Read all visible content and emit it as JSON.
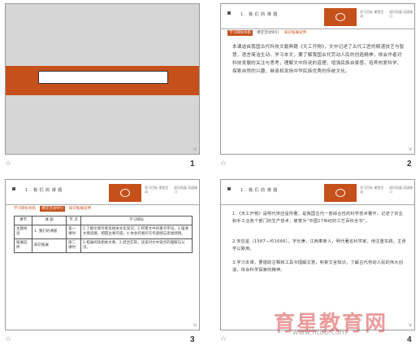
{
  "slides": [
    {
      "page": "1"
    },
    {
      "page": "2",
      "header_text": "1 . 我 们 的 课 题",
      "stamp1": "学习目标 课堂活动",
      "stamp2": "知识拓展 巩固练习",
      "tabs": [
        "学习目标导航",
        "课堂活动导引",
        "知识拓展延伸"
      ],
      "paragraph": "本课选自我国古代科技文献典籍《天工开物》，文中记述了古代工匠的精湛技艺与智慧，语言简洁生动。学习本文，要了解我国古代劳动人民的创造精神，体会作者对科技发展的关注与思考，理解文中所说的道理，增强民族自豪感，培养热爱科学、探索自然的兴趣，继承和发扬中华民族优秀的传统文化。"
    },
    {
      "page": "3",
      "header_text": "1 . 我 们 的 课 题",
      "stamp1": "学习目标 课堂活动",
      "stamp2": "知识拓展 巩固练习",
      "tabs": [
        "学习目标导航",
        "课堂活动导引",
        "知识拓展延伸"
      ],
      "table": {
        "headers": [
          "课节",
          "课 题",
          "节 次",
          "学习目标"
        ],
        "rows": [
          [
            "主题阅读",
            "1. 我们的课题",
            "第一课时",
            "1.了解文章作者及相关文化常识。2.积累文中的重点字词。3.理清文章思路，把握主要内容。4.体会作者的写作意图与思想感情。"
          ],
          [
            "拓展延伸",
            "知识拓展",
            "第二课时",
            "1.拓展阅读相关文章。2.结合实际，谈谈对文中观点的理解与认识。"
          ]
        ]
      }
    },
    {
      "page": "4",
      "header_text": "1 . 我 们 的 课 题",
      "stamp1": "学习目标 课堂活动",
      "stamp2": "知识拓展 巩固练习",
      "paragraphs": [
        "1.《天工开物》是明代宋应星所著，是我国古代一部综合性的科学技术著作，记述了农业和手工业各个部门的生产技术，被誉为“中国17世纪的工艺百科全书”。",
        "2.宋应星（1587—约1666），字长庚，江西奉新人，明代著名科学家，他注重实践，主张学以致用。",
        "3.学习本课，要借助注释和工具书理解文意，积累文言知识，了解古代劳动人民的伟大创造，体会科学探索的精神。"
      ]
    }
  ],
  "watermark": {
    "text": "育星教育网",
    "url": "www.ht88.com"
  },
  "star_glyph": "☆",
  "nav_glyph": "⇲",
  "colors": {
    "accent": "#c6501a"
  }
}
